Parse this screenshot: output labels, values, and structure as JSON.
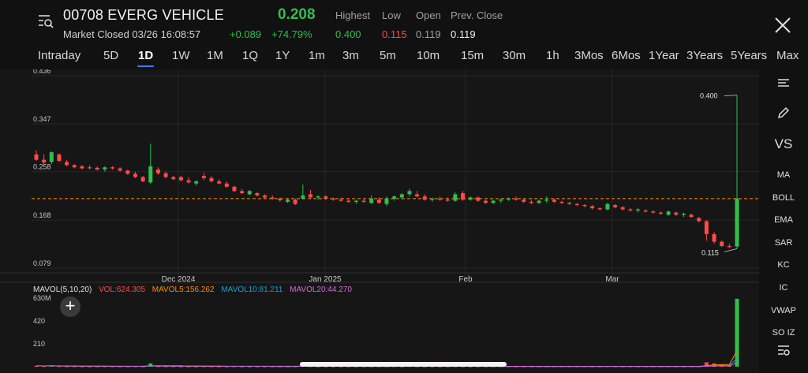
{
  "header": {
    "symbol": "00708 EVERG VEHICLE",
    "price": "0.208",
    "status": "Market Closed 03/26 16:08:57",
    "change": "+0.089",
    "change_pct": "+74.79%",
    "quote": {
      "highest_label": "Highest",
      "highest": "0.400",
      "low_label": "Low",
      "low": "0.115",
      "open_label": "Open",
      "open": "0.119",
      "prev_label": "Prev. Close",
      "prev": "0.119"
    },
    "menu_icon": "list-search-icon",
    "close_icon": "close-icon"
  },
  "tabs": [
    "Intraday",
    "5D",
    "1D",
    "1W",
    "1M",
    "1Q",
    "1Y",
    "1m",
    "3m",
    "5m",
    "10m",
    "15m",
    "30m",
    "1h",
    "3Mos",
    "6Mos",
    "1Year",
    "3Years",
    "5Years",
    "Max"
  ],
  "active_tab": "1D",
  "sidebar": {
    "items": [
      "MA",
      "BOLL",
      "EMA",
      "SAR",
      "KC",
      "IC",
      "VWAP",
      "SO IZ"
    ],
    "vs_label": "VS",
    "icons": [
      "lines-icon",
      "pencil-icon",
      "settings-list-icon"
    ]
  },
  "mavol": {
    "label": "MAVOL(5,10,20)",
    "vol": "VOL:624.305",
    "m5": "MAVOL5:156.262",
    "m10": "MAVOL10:81.211",
    "m20": "MAVOL20:44.270"
  },
  "colors": {
    "up": "#2fbf4d",
    "down": "#ff4a4a",
    "ref": "#ff8a00",
    "vol": "#ff4a4a",
    "m5": "#ff8a00",
    "m10": "#1e9bd7",
    "m20": "#d46bd8"
  },
  "chart_data": {
    "type": "candlestick",
    "y_ticks": [
      "0.436",
      "0.347",
      "0.258",
      "0.168",
      "0.079"
    ],
    "x_labels": [
      "Dec 2024",
      "Jan 2025",
      "Feb",
      "Mar"
    ],
    "vol_ticks": [
      "630M",
      "420",
      "210"
    ],
    "ref_line": 0.208,
    "high_marker": "0.400",
    "low_marker": "0.115",
    "ylim": [
      0.079,
      0.436
    ],
    "candles": [
      {
        "o": 0.29,
        "h": 0.298,
        "l": 0.278,
        "c": 0.28
      },
      {
        "o": 0.28,
        "h": 0.29,
        "l": 0.272,
        "c": 0.275
      },
      {
        "o": 0.276,
        "h": 0.296,
        "l": 0.272,
        "c": 0.294
      },
      {
        "o": 0.29,
        "h": 0.292,
        "l": 0.276,
        "c": 0.278
      },
      {
        "o": 0.276,
        "h": 0.28,
        "l": 0.268,
        "c": 0.27
      },
      {
        "o": 0.27,
        "h": 0.272,
        "l": 0.264,
        "c": 0.266
      },
      {
        "o": 0.268,
        "h": 0.27,
        "l": 0.262,
        "c": 0.264
      },
      {
        "o": 0.266,
        "h": 0.27,
        "l": 0.262,
        "c": 0.265
      },
      {
        "o": 0.265,
        "h": 0.268,
        "l": 0.26,
        "c": 0.262
      },
      {
        "o": 0.262,
        "h": 0.268,
        "l": 0.258,
        "c": 0.266
      },
      {
        "o": 0.266,
        "h": 0.268,
        "l": 0.262,
        "c": 0.264
      },
      {
        "o": 0.264,
        "h": 0.266,
        "l": 0.258,
        "c": 0.26
      },
      {
        "o": 0.26,
        "h": 0.262,
        "l": 0.252,
        "c": 0.254
      },
      {
        "o": 0.254,
        "h": 0.258,
        "l": 0.246,
        "c": 0.248
      },
      {
        "o": 0.248,
        "h": 0.25,
        "l": 0.238,
        "c": 0.24
      },
      {
        "o": 0.238,
        "h": 0.31,
        "l": 0.235,
        "c": 0.268
      },
      {
        "o": 0.262,
        "h": 0.266,
        "l": 0.252,
        "c": 0.255
      },
      {
        "o": 0.255,
        "h": 0.258,
        "l": 0.246,
        "c": 0.248
      },
      {
        "o": 0.248,
        "h": 0.25,
        "l": 0.242,
        "c": 0.244
      },
      {
        "o": 0.248,
        "h": 0.25,
        "l": 0.24,
        "c": 0.242
      },
      {
        "o": 0.242,
        "h": 0.248,
        "l": 0.236,
        "c": 0.238
      },
      {
        "o": 0.236,
        "h": 0.242,
        "l": 0.232,
        "c": 0.24
      },
      {
        "o": 0.25,
        "h": 0.256,
        "l": 0.242,
        "c": 0.246
      },
      {
        "o": 0.246,
        "h": 0.25,
        "l": 0.238,
        "c": 0.24
      },
      {
        "o": 0.24,
        "h": 0.244,
        "l": 0.234,
        "c": 0.236
      },
      {
        "o": 0.236,
        "h": 0.24,
        "l": 0.228,
        "c": 0.23
      },
      {
        "o": 0.23,
        "h": 0.232,
        "l": 0.22,
        "c": 0.222
      },
      {
        "o": 0.222,
        "h": 0.226,
        "l": 0.216,
        "c": 0.218
      },
      {
        "o": 0.216,
        "h": 0.224,
        "l": 0.214,
        "c": 0.222
      },
      {
        "o": 0.218,
        "h": 0.22,
        "l": 0.212,
        "c": 0.214
      },
      {
        "o": 0.214,
        "h": 0.216,
        "l": 0.208,
        "c": 0.21
      },
      {
        "o": 0.21,
        "h": 0.214,
        "l": 0.206,
        "c": 0.208
      },
      {
        "o": 0.208,
        "h": 0.21,
        "l": 0.202,
        "c": 0.205
      },
      {
        "o": 0.202,
        "h": 0.208,
        "l": 0.2,
        "c": 0.206
      },
      {
        "o": 0.206,
        "h": 0.208,
        "l": 0.196,
        "c": 0.198
      },
      {
        "o": 0.208,
        "h": 0.234,
        "l": 0.206,
        "c": 0.214
      },
      {
        "o": 0.216,
        "h": 0.224,
        "l": 0.208,
        "c": 0.21
      },
      {
        "o": 0.21,
        "h": 0.214,
        "l": 0.206,
        "c": 0.212
      },
      {
        "o": 0.212,
        "h": 0.214,
        "l": 0.206,
        "c": 0.208
      },
      {
        "o": 0.208,
        "h": 0.21,
        "l": 0.204,
        "c": 0.206
      },
      {
        "o": 0.206,
        "h": 0.21,
        "l": 0.202,
        "c": 0.204
      },
      {
        "o": 0.204,
        "h": 0.208,
        "l": 0.2,
        "c": 0.202
      },
      {
        "o": 0.202,
        "h": 0.206,
        "l": 0.198,
        "c": 0.204
      },
      {
        "o": 0.204,
        "h": 0.208,
        "l": 0.2,
        "c": 0.202
      },
      {
        "o": 0.2,
        "h": 0.214,
        "l": 0.198,
        "c": 0.208
      },
      {
        "o": 0.206,
        "h": 0.21,
        "l": 0.198,
        "c": 0.2
      },
      {
        "o": 0.198,
        "h": 0.212,
        "l": 0.194,
        "c": 0.208
      },
      {
        "o": 0.208,
        "h": 0.214,
        "l": 0.204,
        "c": 0.212
      },
      {
        "o": 0.21,
        "h": 0.218,
        "l": 0.206,
        "c": 0.216
      },
      {
        "o": 0.216,
        "h": 0.226,
        "l": 0.212,
        "c": 0.222
      },
      {
        "o": 0.216,
        "h": 0.222,
        "l": 0.21,
        "c": 0.212
      },
      {
        "o": 0.212,
        "h": 0.216,
        "l": 0.204,
        "c": 0.206
      },
      {
        "o": 0.206,
        "h": 0.21,
        "l": 0.202,
        "c": 0.208
      },
      {
        "o": 0.208,
        "h": 0.212,
        "l": 0.204,
        "c": 0.206
      },
      {
        "o": 0.206,
        "h": 0.21,
        "l": 0.202,
        "c": 0.204
      },
      {
        "o": 0.204,
        "h": 0.22,
        "l": 0.202,
        "c": 0.216
      },
      {
        "o": 0.218,
        "h": 0.222,
        "l": 0.204,
        "c": 0.206
      },
      {
        "o": 0.206,
        "h": 0.212,
        "l": 0.204,
        "c": 0.21
      },
      {
        "o": 0.21,
        "h": 0.212,
        "l": 0.202,
        "c": 0.204
      },
      {
        "o": 0.204,
        "h": 0.206,
        "l": 0.198,
        "c": 0.2
      },
      {
        "o": 0.2,
        "h": 0.206,
        "l": 0.198,
        "c": 0.204
      },
      {
        "o": 0.204,
        "h": 0.208,
        "l": 0.2,
        "c": 0.206
      },
      {
        "o": 0.206,
        "h": 0.21,
        "l": 0.204,
        "c": 0.208
      },
      {
        "o": 0.208,
        "h": 0.212,
        "l": 0.204,
        "c": 0.206
      },
      {
        "o": 0.206,
        "h": 0.208,
        "l": 0.2,
        "c": 0.202
      },
      {
        "o": 0.202,
        "h": 0.206,
        "l": 0.198,
        "c": 0.2
      },
      {
        "o": 0.2,
        "h": 0.206,
        "l": 0.198,
        "c": 0.204
      },
      {
        "o": 0.204,
        "h": 0.212,
        "l": 0.2,
        "c": 0.206
      },
      {
        "o": 0.206,
        "h": 0.208,
        "l": 0.2,
        "c": 0.202
      },
      {
        "o": 0.202,
        "h": 0.204,
        "l": 0.198,
        "c": 0.2
      },
      {
        "o": 0.2,
        "h": 0.202,
        "l": 0.196,
        "c": 0.198
      },
      {
        "o": 0.198,
        "h": 0.2,
        "l": 0.194,
        "c": 0.196
      },
      {
        "o": 0.196,
        "h": 0.198,
        "l": 0.192,
        "c": 0.194
      },
      {
        "o": 0.194,
        "h": 0.196,
        "l": 0.188,
        "c": 0.19
      },
      {
        "o": 0.19,
        "h": 0.192,
        "l": 0.186,
        "c": 0.188
      },
      {
        "o": 0.188,
        "h": 0.2,
        "l": 0.186,
        "c": 0.198
      },
      {
        "o": 0.196,
        "h": 0.198,
        "l": 0.19,
        "c": 0.192
      },
      {
        "o": 0.192,
        "h": 0.194,
        "l": 0.186,
        "c": 0.188
      },
      {
        "o": 0.188,
        "h": 0.19,
        "l": 0.184,
        "c": 0.186
      },
      {
        "o": 0.186,
        "h": 0.19,
        "l": 0.182,
        "c": 0.188
      },
      {
        "o": 0.186,
        "h": 0.188,
        "l": 0.182,
        "c": 0.184
      },
      {
        "o": 0.184,
        "h": 0.186,
        "l": 0.18,
        "c": 0.182
      },
      {
        "o": 0.182,
        "h": 0.184,
        "l": 0.178,
        "c": 0.18
      },
      {
        "o": 0.178,
        "h": 0.186,
        "l": 0.176,
        "c": 0.184
      },
      {
        "o": 0.182,
        "h": 0.184,
        "l": 0.176,
        "c": 0.178
      },
      {
        "o": 0.178,
        "h": 0.182,
        "l": 0.174,
        "c": 0.18
      },
      {
        "o": 0.178,
        "h": 0.18,
        "l": 0.172,
        "c": 0.174
      },
      {
        "o": 0.172,
        "h": 0.174,
        "l": 0.164,
        "c": 0.166
      },
      {
        "o": 0.166,
        "h": 0.168,
        "l": 0.13,
        "c": 0.142
      },
      {
        "o": 0.142,
        "h": 0.146,
        "l": 0.124,
        "c": 0.128
      },
      {
        "o": 0.128,
        "h": 0.13,
        "l": 0.118,
        "c": 0.12
      },
      {
        "o": 0.12,
        "h": 0.124,
        "l": 0.116,
        "c": 0.119
      },
      {
        "o": 0.119,
        "h": 0.4,
        "l": 0.115,
        "c": 0.208
      }
    ],
    "volumes": [
      8,
      6,
      10,
      5,
      4,
      4,
      3,
      3,
      3,
      4,
      3,
      3,
      3,
      4,
      3,
      30,
      5,
      4,
      4,
      3,
      3,
      3,
      4,
      3,
      3,
      3,
      4,
      3,
      3,
      3,
      3,
      3,
      3,
      3,
      3,
      18,
      4,
      3,
      3,
      3,
      3,
      3,
      3,
      3,
      3,
      3,
      3,
      4,
      3,
      5,
      3,
      3,
      3,
      3,
      3,
      4,
      3,
      3,
      3,
      3,
      3,
      3,
      3,
      3,
      3,
      3,
      3,
      3,
      3,
      3,
      3,
      3,
      3,
      3,
      3,
      4,
      3,
      3,
      3,
      3,
      3,
      3,
      3,
      3,
      3,
      3,
      3,
      3,
      40,
      30,
      20,
      10,
      624
    ]
  }
}
